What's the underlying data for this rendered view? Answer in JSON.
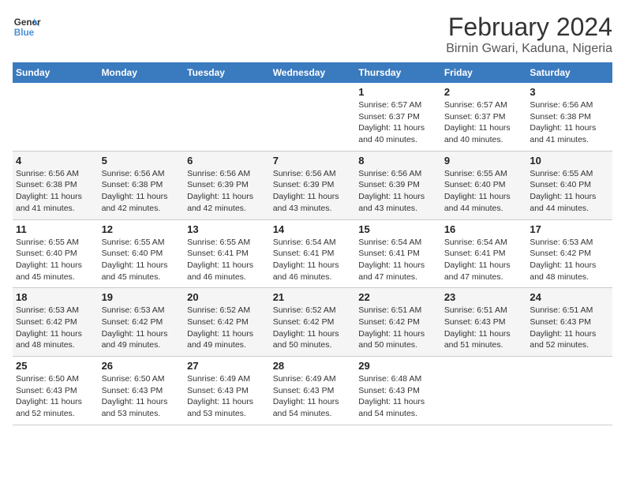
{
  "logo": {
    "line1": "General",
    "line2": "Blue"
  },
  "title": "February 2024",
  "subtitle": "Birnin Gwari, Kaduna, Nigeria",
  "days_of_week": [
    "Sunday",
    "Monday",
    "Tuesday",
    "Wednesday",
    "Thursday",
    "Friday",
    "Saturday"
  ],
  "weeks": [
    [
      {
        "day": "",
        "info": ""
      },
      {
        "day": "",
        "info": ""
      },
      {
        "day": "",
        "info": ""
      },
      {
        "day": "",
        "info": ""
      },
      {
        "day": "1",
        "info": "Sunrise: 6:57 AM\nSunset: 6:37 PM\nDaylight: 11 hours\nand 40 minutes."
      },
      {
        "day": "2",
        "info": "Sunrise: 6:57 AM\nSunset: 6:37 PM\nDaylight: 11 hours\nand 40 minutes."
      },
      {
        "day": "3",
        "info": "Sunrise: 6:56 AM\nSunset: 6:38 PM\nDaylight: 11 hours\nand 41 minutes."
      }
    ],
    [
      {
        "day": "4",
        "info": "Sunrise: 6:56 AM\nSunset: 6:38 PM\nDaylight: 11 hours\nand 41 minutes."
      },
      {
        "day": "5",
        "info": "Sunrise: 6:56 AM\nSunset: 6:38 PM\nDaylight: 11 hours\nand 42 minutes."
      },
      {
        "day": "6",
        "info": "Sunrise: 6:56 AM\nSunset: 6:39 PM\nDaylight: 11 hours\nand 42 minutes."
      },
      {
        "day": "7",
        "info": "Sunrise: 6:56 AM\nSunset: 6:39 PM\nDaylight: 11 hours\nand 43 minutes."
      },
      {
        "day": "8",
        "info": "Sunrise: 6:56 AM\nSunset: 6:39 PM\nDaylight: 11 hours\nand 43 minutes."
      },
      {
        "day": "9",
        "info": "Sunrise: 6:55 AM\nSunset: 6:40 PM\nDaylight: 11 hours\nand 44 minutes."
      },
      {
        "day": "10",
        "info": "Sunrise: 6:55 AM\nSunset: 6:40 PM\nDaylight: 11 hours\nand 44 minutes."
      }
    ],
    [
      {
        "day": "11",
        "info": "Sunrise: 6:55 AM\nSunset: 6:40 PM\nDaylight: 11 hours\nand 45 minutes."
      },
      {
        "day": "12",
        "info": "Sunrise: 6:55 AM\nSunset: 6:40 PM\nDaylight: 11 hours\nand 45 minutes."
      },
      {
        "day": "13",
        "info": "Sunrise: 6:55 AM\nSunset: 6:41 PM\nDaylight: 11 hours\nand 46 minutes."
      },
      {
        "day": "14",
        "info": "Sunrise: 6:54 AM\nSunset: 6:41 PM\nDaylight: 11 hours\nand 46 minutes."
      },
      {
        "day": "15",
        "info": "Sunrise: 6:54 AM\nSunset: 6:41 PM\nDaylight: 11 hours\nand 47 minutes."
      },
      {
        "day": "16",
        "info": "Sunrise: 6:54 AM\nSunset: 6:41 PM\nDaylight: 11 hours\nand 47 minutes."
      },
      {
        "day": "17",
        "info": "Sunrise: 6:53 AM\nSunset: 6:42 PM\nDaylight: 11 hours\nand 48 minutes."
      }
    ],
    [
      {
        "day": "18",
        "info": "Sunrise: 6:53 AM\nSunset: 6:42 PM\nDaylight: 11 hours\nand 48 minutes."
      },
      {
        "day": "19",
        "info": "Sunrise: 6:53 AM\nSunset: 6:42 PM\nDaylight: 11 hours\nand 49 minutes."
      },
      {
        "day": "20",
        "info": "Sunrise: 6:52 AM\nSunset: 6:42 PM\nDaylight: 11 hours\nand 49 minutes."
      },
      {
        "day": "21",
        "info": "Sunrise: 6:52 AM\nSunset: 6:42 PM\nDaylight: 11 hours\nand 50 minutes."
      },
      {
        "day": "22",
        "info": "Sunrise: 6:51 AM\nSunset: 6:42 PM\nDaylight: 11 hours\nand 50 minutes."
      },
      {
        "day": "23",
        "info": "Sunrise: 6:51 AM\nSunset: 6:43 PM\nDaylight: 11 hours\nand 51 minutes."
      },
      {
        "day": "24",
        "info": "Sunrise: 6:51 AM\nSunset: 6:43 PM\nDaylight: 11 hours\nand 52 minutes."
      }
    ],
    [
      {
        "day": "25",
        "info": "Sunrise: 6:50 AM\nSunset: 6:43 PM\nDaylight: 11 hours\nand 52 minutes."
      },
      {
        "day": "26",
        "info": "Sunrise: 6:50 AM\nSunset: 6:43 PM\nDaylight: 11 hours\nand 53 minutes."
      },
      {
        "day": "27",
        "info": "Sunrise: 6:49 AM\nSunset: 6:43 PM\nDaylight: 11 hours\nand 53 minutes."
      },
      {
        "day": "28",
        "info": "Sunrise: 6:49 AM\nSunset: 6:43 PM\nDaylight: 11 hours\nand 54 minutes."
      },
      {
        "day": "29",
        "info": "Sunrise: 6:48 AM\nSunset: 6:43 PM\nDaylight: 11 hours\nand 54 minutes."
      },
      {
        "day": "",
        "info": ""
      },
      {
        "day": "",
        "info": ""
      }
    ]
  ]
}
